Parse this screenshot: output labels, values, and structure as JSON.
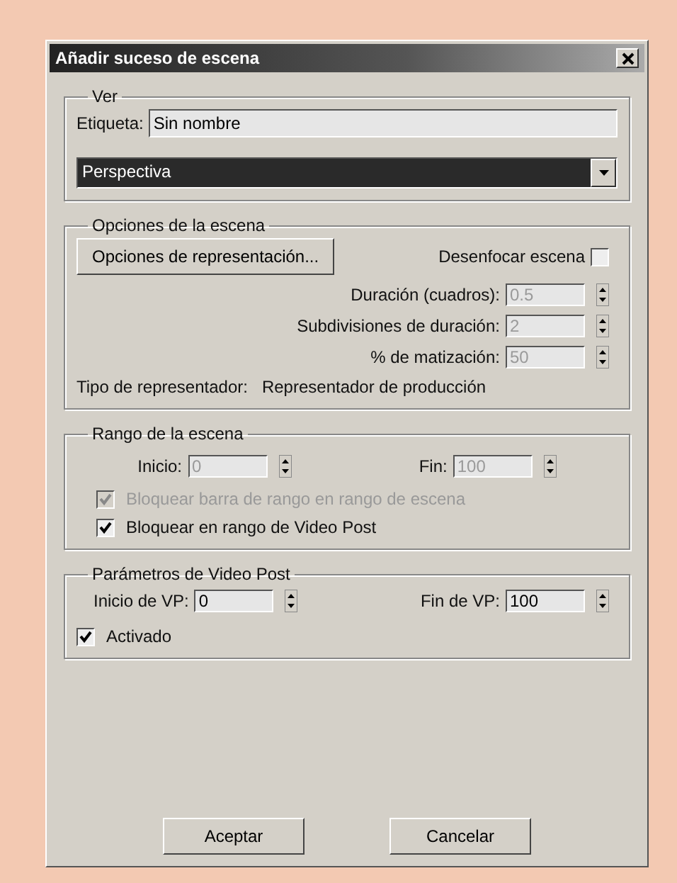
{
  "window": {
    "title": "Añadir suceso de escena"
  },
  "view": {
    "title": "Ver",
    "label_field": {
      "label": "Etiqueta:",
      "value": "Sin nombre"
    },
    "dropdown": {
      "value": "Perspectiva",
      "highlighted": true
    }
  },
  "scene_options": {
    "title": "Opciones de la escena",
    "render_button": "Opciones de representación...",
    "blur": {
      "label": "Desenfocar escena",
      "checked": false
    },
    "spinners": [
      {
        "label": "Duración (cuadros):",
        "value": "0.5",
        "disabled": true
      },
      {
        "label": "Subdivisiones de duración:",
        "value": "2",
        "disabled": true
      },
      {
        "label": "% de matización:",
        "value": "50",
        "disabled": true
      }
    ],
    "renderer": {
      "label": "Tipo de representador:",
      "value": "Representador de producción"
    }
  },
  "scene_range": {
    "title": "Rango de la escena",
    "spinners": [
      {
        "label": "Inicio:",
        "value": "0",
        "disabled": true
      },
      {
        "label": "Fin:",
        "value": "100",
        "disabled": true
      }
    ],
    "checkboxes": [
      {
        "label": "Bloquear barra de rango en rango de escena",
        "checked": true,
        "disabled": true
      },
      {
        "label": "Bloquear en rango de Video Post",
        "checked": true,
        "disabled": false
      }
    ]
  },
  "video_post": {
    "title": "Parámetros de Video Post",
    "spinners": [
      {
        "label": "Inicio de VP:",
        "value": "0",
        "disabled": false
      },
      {
        "label": "Fin de VP:",
        "value": "100",
        "disabled": false
      }
    ],
    "checkboxes": [
      {
        "label": "Activado",
        "checked": true,
        "disabled": false
      }
    ]
  },
  "buttons": [
    "Aceptar",
    "Cancelar"
  ]
}
